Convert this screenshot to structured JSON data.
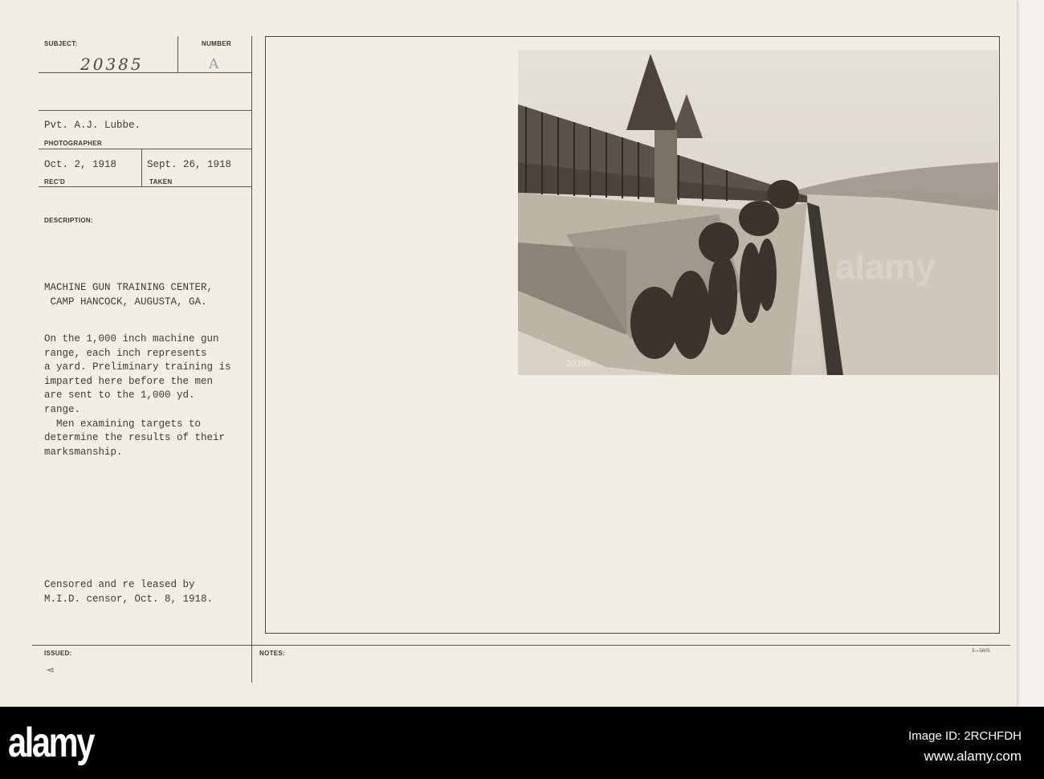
{
  "card": {
    "subject_label": "SUBJECT:",
    "subject_value": "20385",
    "number_label": "NUMBER",
    "number_value": "A",
    "photographer_value": "Pvt. A.J. Lubbe.",
    "photographer_label": "PHOTOGRAPHER",
    "received_value": "Oct. 2, 1918",
    "received_label": "REC'D",
    "taken_value": "Sept. 26, 1918",
    "taken_label": "TAKEN",
    "description_label": "DESCRIPTION:",
    "description_lines": [
      "MACHINE GUN TRAINING CENTER,",
      " CAMP HANCOCK, AUGUSTA, GA."
    ],
    "body_lines": [
      "On the 1,000 inch machine gun",
      "range, each inch represents",
      "a yard. Preliminary training is",
      "imparted here before the men",
      "are sent to the 1,000 yd.",
      "range.",
      "  Men examining targets to",
      "determine the results of their",
      "marksmanship."
    ],
    "censor_lines": [
      "Censored and re leased by",
      "M.I.D. censor, Oct. 8, 1918."
    ],
    "issued_label": "ISSUED:",
    "issued_mark": "◅",
    "notes_label": "NOTES:",
    "form_number": "3—5605",
    "photo_caption": "20385"
  },
  "footer": {
    "logo": "alamy",
    "image_id": "Image ID: 2RCHFDH",
    "site": "www.alamy.com"
  },
  "colors": {
    "paper": "#f3eee4",
    "ink": "#3d3a36",
    "footer": "#000000"
  }
}
